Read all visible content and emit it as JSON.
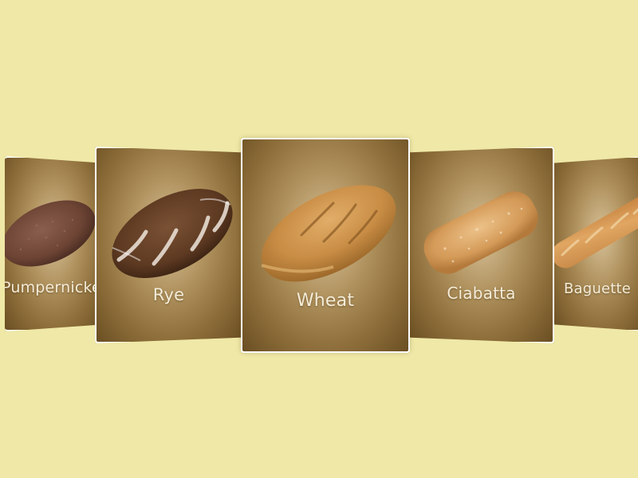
{
  "carousel": {
    "items": [
      {
        "label": "Pumpernickel",
        "icon": "pumpernickel-loaf-image"
      },
      {
        "label": "Rye",
        "icon": "rye-loaf-image"
      },
      {
        "label": "Wheat",
        "icon": "wheat-loaf-image"
      },
      {
        "label": "Ciabatta",
        "icon": "ciabatta-loaf-image"
      },
      {
        "label": "Baguette",
        "icon": "baguette-loaf-image"
      }
    ],
    "selected_index": 2
  },
  "colors": {
    "page_background": "#efe8a7",
    "card_frame": "#ffffff",
    "card_gradient_center": "#d7c29a",
    "card_gradient_edge": "#6a4e22",
    "label_text": "#f4ecd8"
  }
}
